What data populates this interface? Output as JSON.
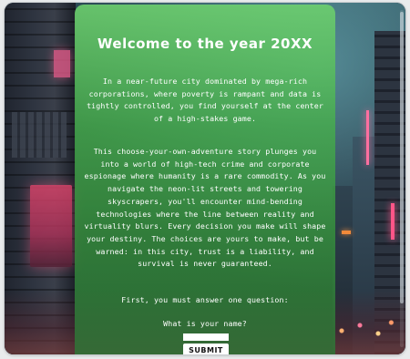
{
  "story": {
    "title": "Welcome to the year 20XX",
    "intro": "In a near-future city dominated by mega-rich corporations, where poverty is rampant and data is tightly controlled, you find yourself at the center of a high-stakes game.",
    "body": "This choose-your-own-adventure story plunges you into a world of high-tech crime and corporate espionage where humanity is a rare commodity. As you navigate the neon-lit streets and towering skyscrapers, you'll encounter mind-bending technologies where the line between reality and virtuality blurs. Every decision you make will shape your destiny. The choices are yours to make, but be warned: in this city, trust is a liability, and survival is never guaranteed.",
    "prompt": "First, you must answer one question:",
    "question": "What is your name?"
  },
  "form": {
    "name_value": "",
    "name_placeholder": "",
    "submit_label": "SUBMIT"
  },
  "colors": {
    "panel_green": "#5fbf63",
    "text": "#ffffff",
    "neon_pink": "#e05a88"
  }
}
